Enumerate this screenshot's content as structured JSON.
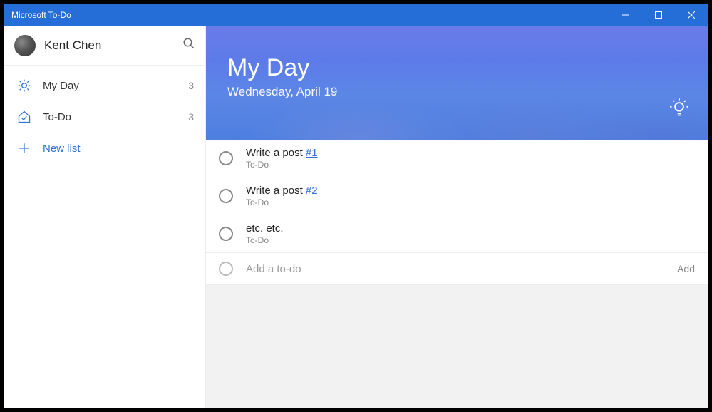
{
  "titlebar": {
    "title": "Microsoft To-Do"
  },
  "profile": {
    "name": "Kent Chen"
  },
  "sidebar": {
    "items": [
      {
        "label": "My Day",
        "count": "3"
      },
      {
        "label": "To-Do",
        "count": "3"
      }
    ],
    "new_list_label": "New list"
  },
  "hero": {
    "title": "My Day",
    "date": "Wednesday, April 19"
  },
  "tasks": [
    {
      "title_prefix": "Write a post ",
      "title_link": "#1",
      "sub": "To-Do"
    },
    {
      "title_prefix": "Write a post ",
      "title_link": "#2",
      "sub": "To-Do"
    },
    {
      "title_prefix": "etc. etc.",
      "title_link": "",
      "sub": "To-Do"
    }
  ],
  "add": {
    "placeholder": "Add a to-do",
    "button": "Add"
  }
}
